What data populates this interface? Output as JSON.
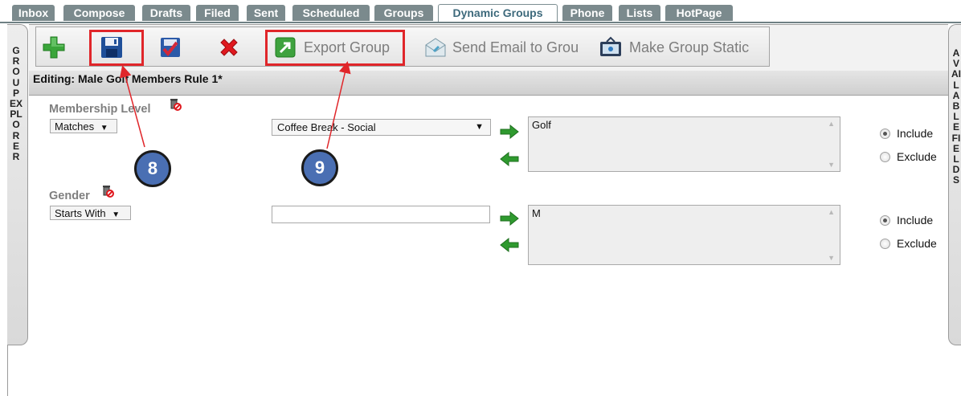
{
  "tabs": [
    {
      "label": "Inbox",
      "active": false
    },
    {
      "label": "Compose",
      "active": false
    },
    {
      "label": "Drafts",
      "active": false
    },
    {
      "label": "Filed",
      "active": false
    },
    {
      "label": "Sent",
      "active": false
    },
    {
      "label": "Scheduled",
      "active": false
    },
    {
      "label": "Groups",
      "active": false
    },
    {
      "label": "Dynamic Groups",
      "active": true
    },
    {
      "label": "Phone",
      "active": false
    },
    {
      "label": "Lists",
      "active": false
    },
    {
      "label": "HotPage",
      "active": false
    }
  ],
  "side_panels": {
    "left_label": "GROUP EXPLORER",
    "right_label": "AVAILABLE FIELDS"
  },
  "toolbar": {
    "add_icon": "plus-icon",
    "save_icon": "floppy-disk-icon",
    "save_check_icon": "save-check-icon",
    "delete_icon": "red-x-icon",
    "export_label": "Export Group",
    "send_email_label": "Send Email to Grou",
    "make_static_label": "Make Group Static"
  },
  "editor": {
    "title": "Editing: Male Golf Members Rule 1*"
  },
  "rules": [
    {
      "field_label": "Membership Level",
      "operator": "Matches",
      "value_select": "Coffee Break - Social",
      "list_values": "Golf",
      "include_label": "Include",
      "exclude_label": "Exclude",
      "selected": "include"
    },
    {
      "field_label": "Gender",
      "operator": "Starts With",
      "value_input": "",
      "list_values": "M",
      "include_label": "Include",
      "exclude_label": "Exclude",
      "selected": "include"
    }
  ],
  "callouts": {
    "first": "8",
    "second": "9"
  },
  "colors": {
    "tab_bg": "#7b8a8d",
    "active_tab_text": "#3e6a7c",
    "highlight_red": "#e0262a",
    "callout_blue": "#4a6fb3",
    "arrow_green": "#2f9a2f"
  }
}
